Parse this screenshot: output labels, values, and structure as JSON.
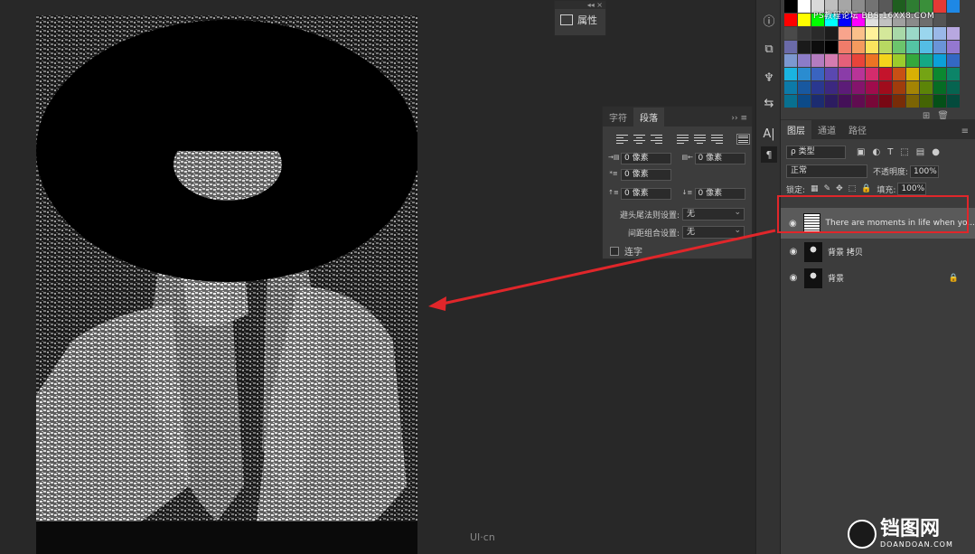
{
  "properties_panel": {
    "label": "属性",
    "collapse_glyph": "◂◂ ×"
  },
  "paragraph_panel": {
    "tabs": [
      "字符",
      "段落"
    ],
    "active_tab": 1,
    "menu_glyph": "›› ≡",
    "indent_left": "0 像素",
    "indent_right": "0 像素",
    "indent_first": "0 像素",
    "space_before": "0 像素",
    "space_after": "0 像素",
    "kinsoku_label": "避头尾法则设置:",
    "kinsoku_value": "无",
    "mojikumi_label": "间距组合设置:",
    "mojikumi_value": "无",
    "hyphenate_label": "连字"
  },
  "watermark": "PS教程论坛 BBS.16XX8.COM",
  "swatch_colors": [
    "#000000",
    "#ffffff",
    "#d9d9d9",
    "#bfbfbf",
    "#a6a6a6",
    "#8c8c8c",
    "#737373",
    "#595959",
    "#1f5e1f",
    "#2e7d32",
    "#3a8f3a",
    "#e53935",
    "#1e88e5",
    "#ff0000",
    "#ffff00",
    "#00ff00",
    "#00ffff",
    "#0000ff",
    "#ff00ff",
    "#e0e0e0",
    "#c2c2c2",
    "#a0a0a0",
    "#8a8a8a",
    "#6e6e6e",
    "#545454",
    "#3d3d3d",
    "#4a4a4a",
    "#363636",
    "#2a2a2a",
    "#1c1c1c",
    "#f8a48c",
    "#fbc08a",
    "#fff29a",
    "#d4e89a",
    "#a8d8a8",
    "#9ad8c8",
    "#9ad6ee",
    "#9ab8e8",
    "#b8a8e0",
    "#6a6aa8",
    "#1a1a1a",
    "#0d0d0d",
    "#000000",
    "#f07c6a",
    "#f59a5e",
    "#fbe45e",
    "#b8d862",
    "#6cc46c",
    "#54c4a4",
    "#54bde4",
    "#6a94d8",
    "#9478d0",
    "#7c98d0",
    "#8c7cc8",
    "#b47cc0",
    "#d47cb0",
    "#e4607a",
    "#e8443a",
    "#ec7424",
    "#f4d41c",
    "#9ccc2c",
    "#34a83c",
    "#14a884",
    "#0ca0d8",
    "#3468c4",
    "#1ab4e0",
    "#2a8cd0",
    "#3a64c0",
    "#5a48b0",
    "#8a3ca8",
    "#b83498",
    "#d42c6c",
    "#c4142c",
    "#c85014",
    "#d8b004",
    "#74a414",
    "#0c8830",
    "#0c8468",
    "#0c7aa8",
    "#1858a0",
    "#2a3890",
    "#3c2880",
    "#5c1c78",
    "#84146c",
    "#a00c4c",
    "#a00c1c",
    "#a03c0c",
    "#a48404",
    "#5c8408",
    "#066c24",
    "#066450",
    "#087090",
    "#0c4a88",
    "#1c2c70",
    "#2c1c60",
    "#441058",
    "#600c50",
    "#780838",
    "#780814",
    "#782c08",
    "#7c6404",
    "#446404",
    "#045018",
    "#044a3c"
  ],
  "layers_panel": {
    "tabs": [
      "图层",
      "通道",
      "路径"
    ],
    "filter_value": "ρ 类型",
    "blend_mode": "正常",
    "opacity_label": "不透明度:",
    "opacity_value": "100%",
    "lock_label": "锁定:",
    "fill_label": "填充:",
    "fill_value": "100%",
    "layers": [
      {
        "name": "There are moments in life when yo...",
        "selected": true,
        "locked": false
      },
      {
        "name": "背景 拷贝",
        "selected": false,
        "locked": false
      },
      {
        "name": "背景",
        "selected": false,
        "locked": true
      }
    ]
  },
  "canvas_watermark": "UI·cn",
  "logo": {
    "big": "铛图网",
    "small": "DOANDOAN.COM"
  },
  "accent": "#e0262a"
}
